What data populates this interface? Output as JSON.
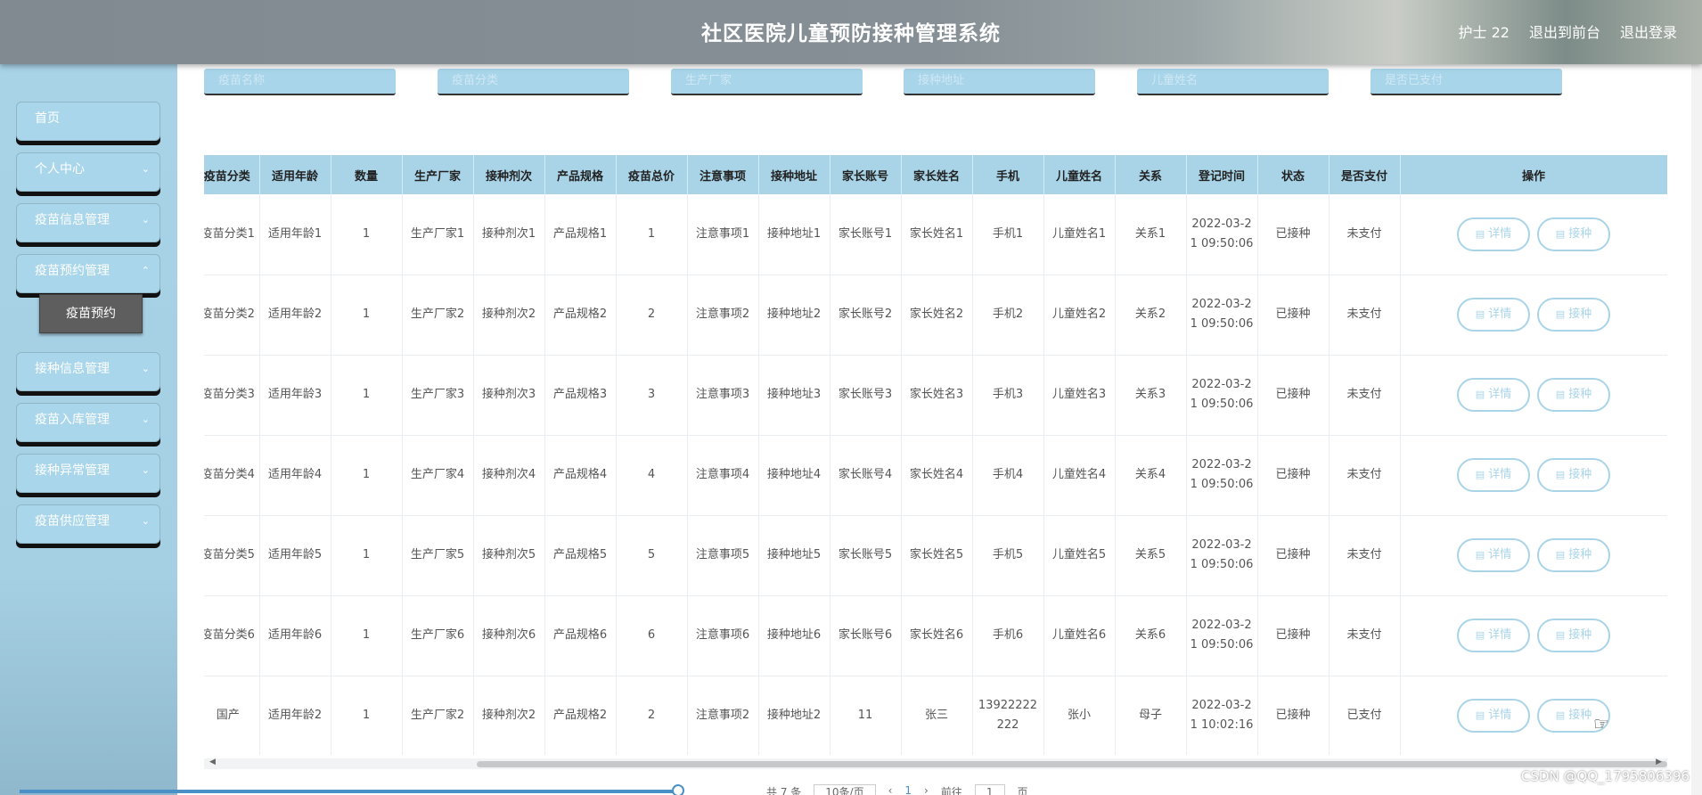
{
  "header": {
    "title": "社区医院儿童预防接种管理系统",
    "user": "护士 22",
    "to_front": "退出到前台",
    "logout": "退出登录"
  },
  "sidebar": {
    "items": [
      {
        "label": "首页",
        "has_chevron": false
      },
      {
        "label": "个人中心",
        "has_chevron": true
      },
      {
        "label": "疫苗信息管理",
        "has_chevron": true
      },
      {
        "label": "疫苗预约管理",
        "has_chevron": true
      },
      {
        "label": "接种信息管理",
        "has_chevron": true
      },
      {
        "label": "疫苗入库管理",
        "has_chevron": true
      },
      {
        "label": "接种异常管理",
        "has_chevron": true
      },
      {
        "label": "疫苗供应管理",
        "has_chevron": true
      }
    ],
    "submenu_active": "疫苗预约"
  },
  "filters": [
    "疫苗名称",
    "疫苗分类",
    "生产厂家",
    "接种地址",
    "儿童姓名",
    "是否已支付"
  ],
  "table": {
    "headers": [
      "疫苗分类",
      "适用年龄",
      "数量",
      "生产厂家",
      "接种剂次",
      "产品规格",
      "疫苗总价",
      "注意事项",
      "接种地址",
      "家长账号",
      "家长姓名",
      "手机",
      "儿童姓名",
      "关系",
      "登记时间",
      "状态",
      "是否支付",
      "操作"
    ],
    "detail_label": "详情",
    "vaccinate_label": "接种",
    "rows": [
      [
        "疫苗分类1",
        "适用年龄1",
        "1",
        "生产厂家1",
        "接种剂次1",
        "产品规格1",
        "1",
        "注意事项1",
        "接种地址1",
        "家长账号1",
        "家长姓名1",
        "手机1",
        "儿童姓名1",
        "关系1",
        "2022-03-21 09:50:06",
        "已接种",
        "未支付"
      ],
      [
        "疫苗分类2",
        "适用年龄2",
        "1",
        "生产厂家2",
        "接种剂次2",
        "产品规格2",
        "2",
        "注意事项2",
        "接种地址2",
        "家长账号2",
        "家长姓名2",
        "手机2",
        "儿童姓名2",
        "关系2",
        "2022-03-21 09:50:06",
        "已接种",
        "未支付"
      ],
      [
        "疫苗分类3",
        "适用年龄3",
        "1",
        "生产厂家3",
        "接种剂次3",
        "产品规格3",
        "3",
        "注意事项3",
        "接种地址3",
        "家长账号3",
        "家长姓名3",
        "手机3",
        "儿童姓名3",
        "关系3",
        "2022-03-21 09:50:06",
        "已接种",
        "未支付"
      ],
      [
        "疫苗分类4",
        "适用年龄4",
        "1",
        "生产厂家4",
        "接种剂次4",
        "产品规格4",
        "4",
        "注意事项4",
        "接种地址4",
        "家长账号4",
        "家长姓名4",
        "手机4",
        "儿童姓名4",
        "关系4",
        "2022-03-21 09:50:06",
        "已接种",
        "未支付"
      ],
      [
        "疫苗分类5",
        "适用年龄5",
        "1",
        "生产厂家5",
        "接种剂次5",
        "产品规格5",
        "5",
        "注意事项5",
        "接种地址5",
        "家长账号5",
        "家长姓名5",
        "手机5",
        "儿童姓名5",
        "关系5",
        "2022-03-21 09:50:06",
        "已接种",
        "未支付"
      ],
      [
        "疫苗分类6",
        "适用年龄6",
        "1",
        "生产厂家6",
        "接种剂次6",
        "产品规格6",
        "6",
        "注意事项6",
        "接种地址6",
        "家长账号6",
        "家长姓名6",
        "手机6",
        "儿童姓名6",
        "关系6",
        "2022-03-21 09:50:06",
        "已接种",
        "未支付"
      ],
      [
        "国产",
        "适用年龄2",
        "1",
        "生产厂家2",
        "接种剂次2",
        "产品规格2",
        "2",
        "注意事项2",
        "接种地址2",
        "11",
        "张三",
        "13922222222",
        "张小",
        "母子",
        "2022-03-21 10:02:16",
        "已接种",
        "已支付"
      ]
    ]
  },
  "pagination": {
    "total": "共 7 条",
    "page_size": "10条/页",
    "current_page": "1",
    "goto_label": "前往",
    "goto_value": "1",
    "page_unit": "页"
  },
  "watermark": "CSDN @QQ_1795806396",
  "colors": {
    "accent": "#a9d4e8",
    "header_bg": "#858f95",
    "sidebar_bg": "#a8d2e6",
    "submenu_bg": "#5e5e5e"
  }
}
